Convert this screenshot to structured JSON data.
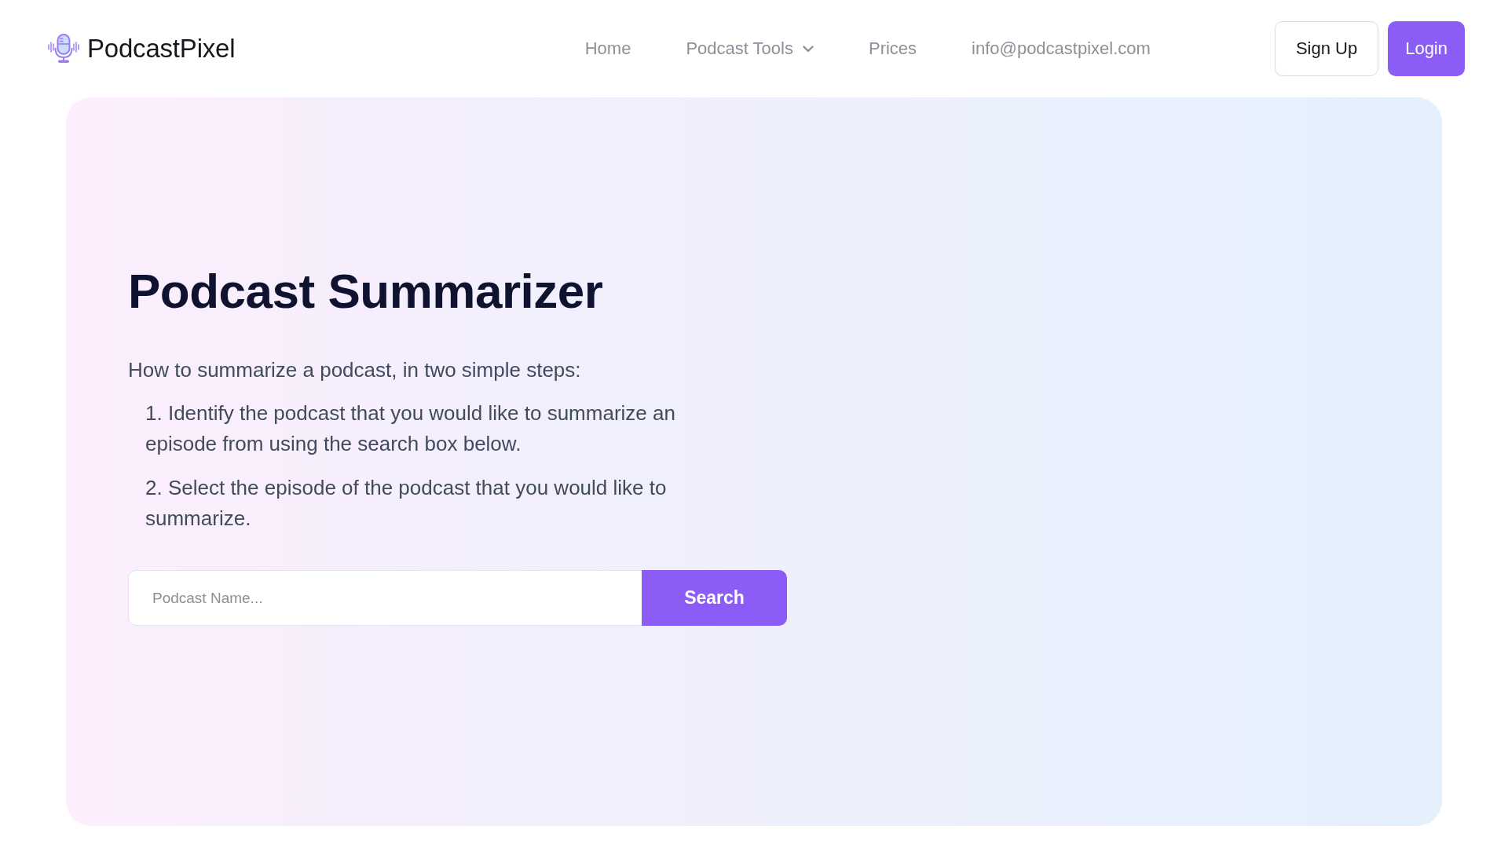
{
  "header": {
    "logo": {
      "name": "PodcastPixel"
    },
    "nav": [
      {
        "label": "Home",
        "kind": "link"
      },
      {
        "label": "Podcast Tools",
        "kind": "dropdown"
      },
      {
        "label": "Prices",
        "kind": "link"
      },
      {
        "label": "info@podcastpixel.com",
        "kind": "link"
      }
    ],
    "buttons": [
      {
        "label": "Sign Up",
        "kind": "outline"
      },
      {
        "label": "Login",
        "kind": "primary"
      }
    ]
  },
  "hero": {
    "title": "Podcast Summarizer",
    "intro": "How to summarize a podcast, in two simple steps:",
    "steps": [
      "1. Identify the podcast that you would like to summarize an episode from using the search box below.",
      "2. Select the episode of the podcast that you would like to summarize."
    ],
    "search": {
      "placeholder": "Podcast Name...",
      "button": "Search"
    }
  }
}
